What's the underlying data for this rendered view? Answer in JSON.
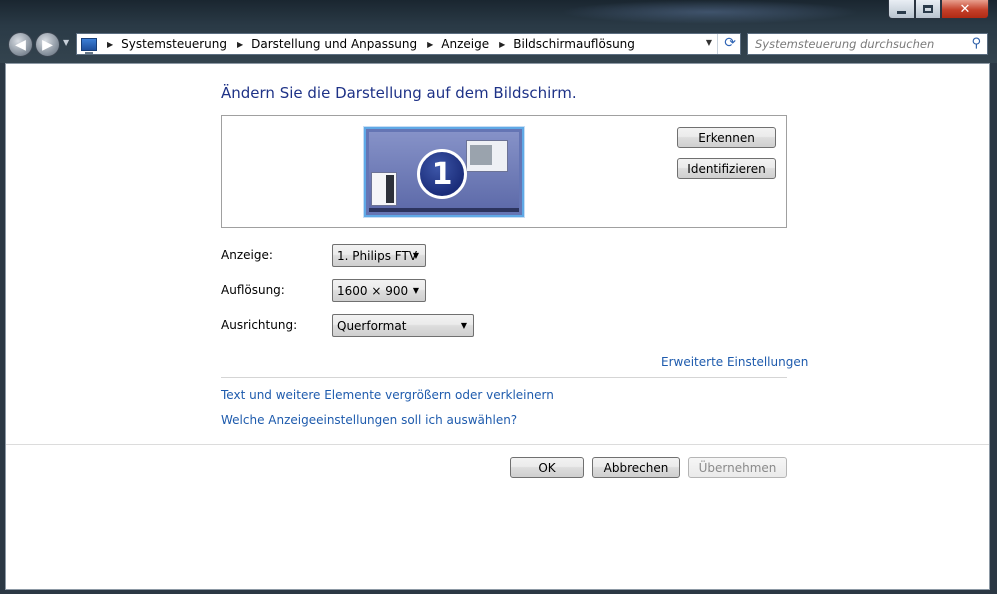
{
  "window": {
    "minimize_symbol": "–",
    "maximize_symbol": "□",
    "close_symbol": "✕"
  },
  "navigation": {
    "back_icon": "◀",
    "forward_icon": "▶"
  },
  "breadcrumb": {
    "items": [
      {
        "label": "Systemsteuerung"
      },
      {
        "label": "Darstellung und Anpassung"
      },
      {
        "label": "Anzeige"
      },
      {
        "label": "Bildschirmauflösung"
      }
    ]
  },
  "search": {
    "placeholder": "Systemsteuerung durchsuchen"
  },
  "page": {
    "title": "Ändern Sie die Darstellung auf dem Bildschirm."
  },
  "monitor_preview": {
    "number": "1",
    "detect_label": "Erkennen",
    "identify_label": "Identifizieren"
  },
  "settings": {
    "display_label": "Anzeige:",
    "display_value": "1. Philips FTV",
    "resolution_label": "Auflösung:",
    "resolution_value": "1600 × 900",
    "orientation_label": "Ausrichtung:",
    "orientation_value": "Querformat"
  },
  "links": {
    "advanced": "Erweiterte Einstellungen",
    "text_size": "Text und weitere Elemente vergrößern oder verkleinern",
    "which_settings": "Welche Anzeigeeinstellungen soll ich auswählen?"
  },
  "footer": {
    "ok_label": "OK",
    "cancel_label": "Abbrechen",
    "apply_label": "Übernehmen"
  },
  "colors": {
    "title": "#1e3287",
    "link": "#1e5bad",
    "window_frame": "#2b3844"
  }
}
